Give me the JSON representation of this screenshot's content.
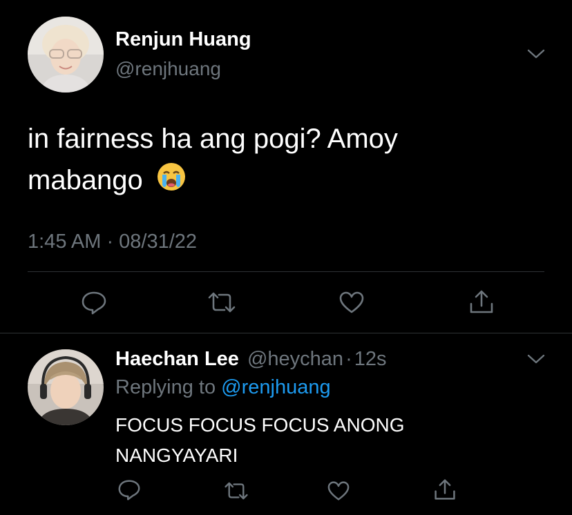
{
  "main_tweet": {
    "author_name": "Renjun Huang",
    "author_handle": "@renjhuang",
    "text_line1": "in fairness ha ang pogi? Amoy",
    "text_line2": "mabango",
    "emoji": "😭",
    "timestamp": "1:45 AM · 08/31/22"
  },
  "reply": {
    "author_name": "Haechan Lee",
    "author_handle": "@heychan",
    "separator": "·",
    "time_ago": "12s",
    "replying_to_label": "Replying to",
    "replying_to_handle": "@renjhuang",
    "text_line1": "FOCUS FOCUS FOCUS ANONG",
    "text_line2": "NANGYAYARI"
  },
  "icons": {
    "reply": "speech-bubble",
    "retweet": "arrows-loop",
    "like": "heart",
    "share": "upload-arrow",
    "more": "chevron-down"
  },
  "colors": {
    "background": "#000000",
    "text": "#ffffff",
    "secondary": "#6e767d",
    "link": "#1d9bf0",
    "divider": "#2f3336"
  }
}
